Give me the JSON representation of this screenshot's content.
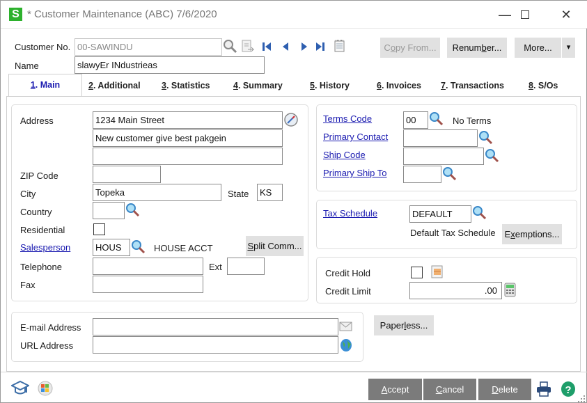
{
  "window": {
    "title": "* Customer Maintenance (ABC) 7/6/2020",
    "logo_letter": "S",
    "minimize": "—",
    "maximize": "☐",
    "close": "✕"
  },
  "header": {
    "customer_no_label": "Customer No.",
    "customer_no_value": "00-SAWINDU",
    "name_label": "Name",
    "name_value": "slawyEr INdustrieas",
    "copy_from": {
      "pre": "C",
      "u": "o",
      "post": "py From..."
    },
    "renumber": {
      "pre": "Renum",
      "u": "b",
      "post": "er..."
    },
    "more": "More...",
    "more_dropdown": "▾"
  },
  "tabs": [
    {
      "num": "1",
      "label": ". Main",
      "active": true
    },
    {
      "num": "2",
      "label": ". Additional"
    },
    {
      "num": "3",
      "label": ". Statistics"
    },
    {
      "num": "4",
      "label": ". Summary"
    },
    {
      "num": "5",
      "label": ". History"
    },
    {
      "num": "6",
      "label": ". Invoices"
    },
    {
      "num": "7",
      "label": ". Transactions"
    },
    {
      "num": "8",
      "label": ". S/Os"
    }
  ],
  "address": {
    "address_label": "Address",
    "line1": "1234 Main Street",
    "line2": "New customer give best pakgein",
    "line3": "",
    "zip_label": "ZIP Code",
    "zip": "",
    "city_label": "City",
    "city": "Topeka",
    "state_label": "State",
    "state": "KS",
    "country_label": "Country",
    "country": "",
    "residential_label": "Residential",
    "residential_checked": false,
    "salesperson_label": "Salesperson",
    "salesperson": "HOUS",
    "salesperson_name": "HOUSE ACCT",
    "split_comm": {
      "pre": "",
      "u": "S",
      "post": "plit Comm..."
    },
    "telephone_label": "Telephone",
    "telephone": "",
    "ext_label": "Ext",
    "ext": "",
    "fax_label": "Fax",
    "fax": ""
  },
  "terms": {
    "terms_code_label": "Terms Code",
    "terms_code": "00",
    "terms_desc": "No Terms",
    "primary_contact_label": "Primary Contact",
    "primary_contact": "",
    "ship_code_label": "Ship Code",
    "ship_code": "",
    "primary_ship_to_label": "Primary Ship To",
    "primary_ship_to": ""
  },
  "tax": {
    "tax_schedule_label": "Tax Schedule",
    "tax_schedule": "DEFAULT",
    "tax_schedule_desc": "Default Tax Schedule",
    "exemptions": {
      "pre": "E",
      "u": "x",
      "post": "emptions..."
    }
  },
  "credit": {
    "credit_hold_label": "Credit Hold",
    "credit_hold_checked": false,
    "credit_limit_label": "Credit Limit",
    "credit_limit": ".00"
  },
  "contact": {
    "email_label": "E-mail Address",
    "email": "",
    "url_label": "URL Address",
    "url": "",
    "paperless": {
      "pre": "Paper",
      "u": "l",
      "post": "ess..."
    }
  },
  "footer": {
    "accept": {
      "u": "A",
      "post": "ccept"
    },
    "cancel": {
      "u": "C",
      "post": "ancel"
    },
    "delete": {
      "u": "D",
      "post": "elete"
    }
  },
  "colors": {
    "link": "#1a1ab0",
    "logo_green": "#2db12d",
    "footer_button": "#7b7b7b",
    "button": "#e1e1e1"
  }
}
